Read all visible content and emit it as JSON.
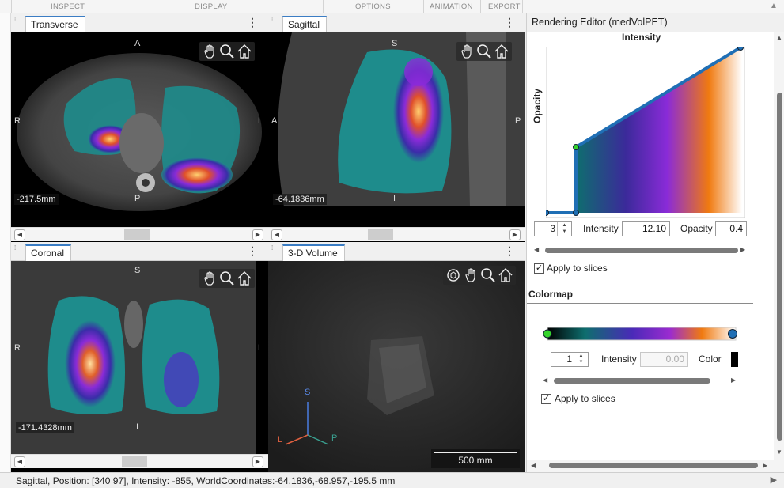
{
  "toolstrip": {
    "sections": [
      "INSPECT",
      "DISPLAY",
      "OPTIONS",
      "ANIMATION",
      "EXPORT"
    ]
  },
  "panels": {
    "transverse": {
      "tab": "Transverse",
      "top": "A",
      "bottom": "P",
      "left": "R",
      "right": "L",
      "distance": "-217.5mm"
    },
    "sagittal": {
      "tab": "Sagittal",
      "top": "S",
      "bottom": "I",
      "left": "A",
      "right": "P",
      "distance": "-64.1836mm"
    },
    "coronal": {
      "tab": "Coronal",
      "top": "S",
      "bottom": "I",
      "left": "R",
      "right": "L",
      "distance": "-171.4328mm"
    },
    "volume": {
      "tab": "3-D Volume",
      "axis_s": "S",
      "axis_l": "L",
      "axis_p": "P",
      "scalebar": "500 mm"
    }
  },
  "editor": {
    "title": "Rendering Editor (medVolPET)",
    "chart_title": "Intensity",
    "y_label": "Opacity",
    "point_index": "3",
    "intensity_label": "Intensity",
    "intensity_value": "12.10",
    "opacity_label": "Opacity",
    "opacity_value": "0.4",
    "apply_slices_1": "Apply to slices",
    "colormap_heading": "Colormap",
    "cmap_point_index": "1",
    "cmap_intensity_label": "Intensity",
    "cmap_intensity_value": "0.00",
    "color_label": "Color",
    "apply_slices_2": "Apply to slices"
  },
  "status": {
    "text": "Sagittal, Position: [340 97], Intensity: -855, WorldCoordinates:-64.1836,-68.957,-195.5 mm"
  },
  "colors": {
    "accent": "#3b7dc4",
    "curve": "#1f6fb5",
    "point_selected": "#35d62c"
  }
}
